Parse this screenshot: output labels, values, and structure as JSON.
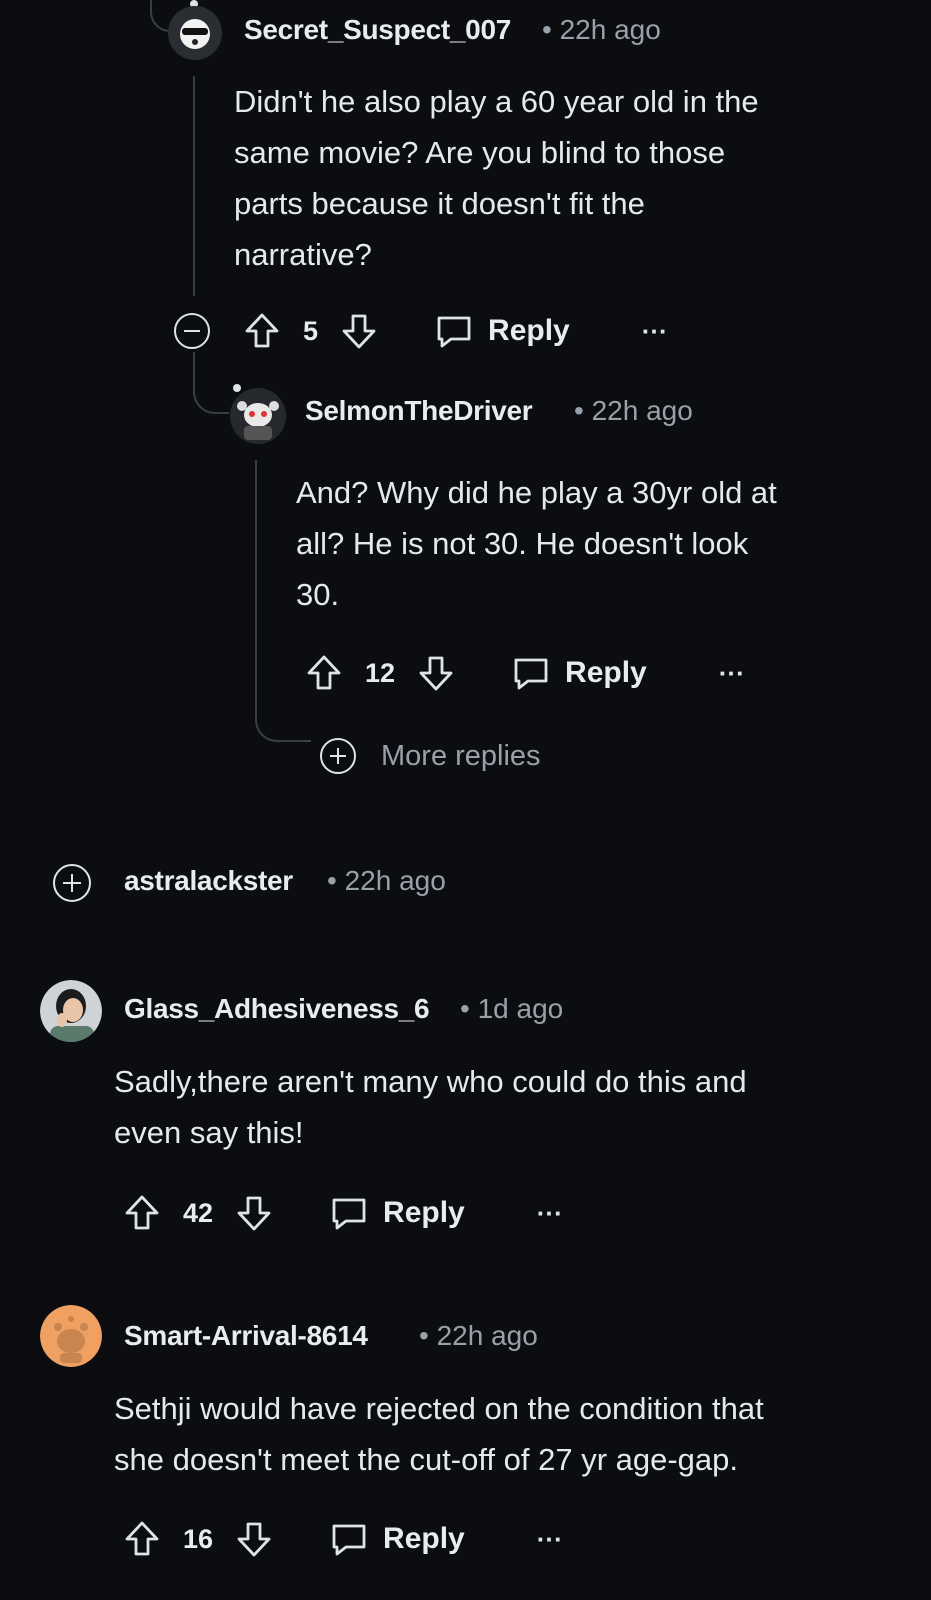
{
  "comments": [
    {
      "username": "Secret_Suspect_007",
      "time": "22h ago",
      "body_lines": [
        "Didn't he also play a 60 year old in the",
        "same movie? Are you blind to those",
        "parts because it doesn't fit the",
        "narrative?"
      ],
      "votes": "5",
      "reply_label": "Reply",
      "more_label": "···"
    },
    {
      "username": "SelmonTheDriver",
      "time": "22h ago",
      "body_lines": [
        "And? Why did he play a 30yr old at",
        "all? He is not 30. He doesn't look",
        "30."
      ],
      "votes": "12",
      "reply_label": "Reply",
      "more_label": "···"
    },
    {
      "username": "astralackster",
      "time": "22h ago"
    },
    {
      "username": "Glass_Adhesiveness_6",
      "time": "1d ago",
      "body_lines": [
        "Sadly,there aren't many who could do this and",
        "even say this!"
      ],
      "votes": "42",
      "reply_label": "Reply",
      "more_label": "···"
    },
    {
      "username": "Smart-Arrival-8614",
      "time": "22h ago",
      "body_lines": [
        "Sethji would have rejected on the condition that",
        "she doesn't meet the cut-off of 27 yr age-gap."
      ],
      "votes": "16",
      "reply_label": "Reply",
      "more_label": "···"
    }
  ],
  "more_replies_label": "More replies",
  "separator": "•",
  "colors": {
    "background": "#0b0d10",
    "text": "#e6e9ec",
    "muted": "#98a1a9",
    "thread_line": "#3a3e43",
    "avatar_orange": "#f0a060"
  },
  "icons": [
    "upvote-icon",
    "downvote-icon",
    "comment-bubble-icon",
    "more-options-icon",
    "collapse-icon",
    "expand-icon"
  ]
}
